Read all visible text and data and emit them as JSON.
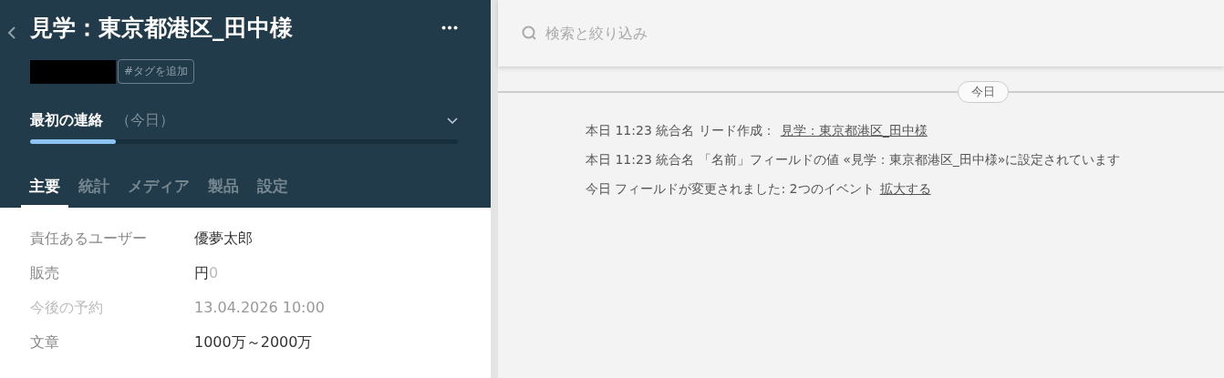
{
  "header": {
    "title": "見学：東京都港区_田中様",
    "add_tag": "#タグを追加"
  },
  "stage": {
    "name": "最初の連絡",
    "when": "（今日）",
    "level": 0.2
  },
  "tabs": [
    {
      "label": "主要",
      "selected": true
    },
    {
      "label": "統計",
      "selected": false
    },
    {
      "label": "メディア",
      "selected": false
    },
    {
      "label": "製品",
      "selected": false
    },
    {
      "label": "設定",
      "selected": false
    }
  ],
  "fields": [
    {
      "kind": "text",
      "label": "責任あるユーザー",
      "value": "優夢太郎",
      "disabled": false
    },
    {
      "kind": "money",
      "label": "販売",
      "currency": "円",
      "amount": "0",
      "disabled": false
    },
    {
      "kind": "text",
      "label": "今後の予約",
      "value": "13.04.2026 10:00",
      "disabled": true
    },
    {
      "kind": "text",
      "label": "文章",
      "value": "1000万～2000万",
      "disabled": false
    }
  ],
  "search": {
    "placeholder": "検索と絞り込み"
  },
  "feed": {
    "date": "今日",
    "events": [
      {
        "text": "本日 11:23 統合名 リード作成：",
        "link": "見学：東京都港区_田中様"
      },
      {
        "text": "本日 11:23 統合名 「名前」フィールドの値 «見学：東京都港区_田中様»に設定されています"
      },
      {
        "text": "今日 フィールドが変更されました: 2つのイベント",
        "link": "拡大する"
      }
    ]
  }
}
